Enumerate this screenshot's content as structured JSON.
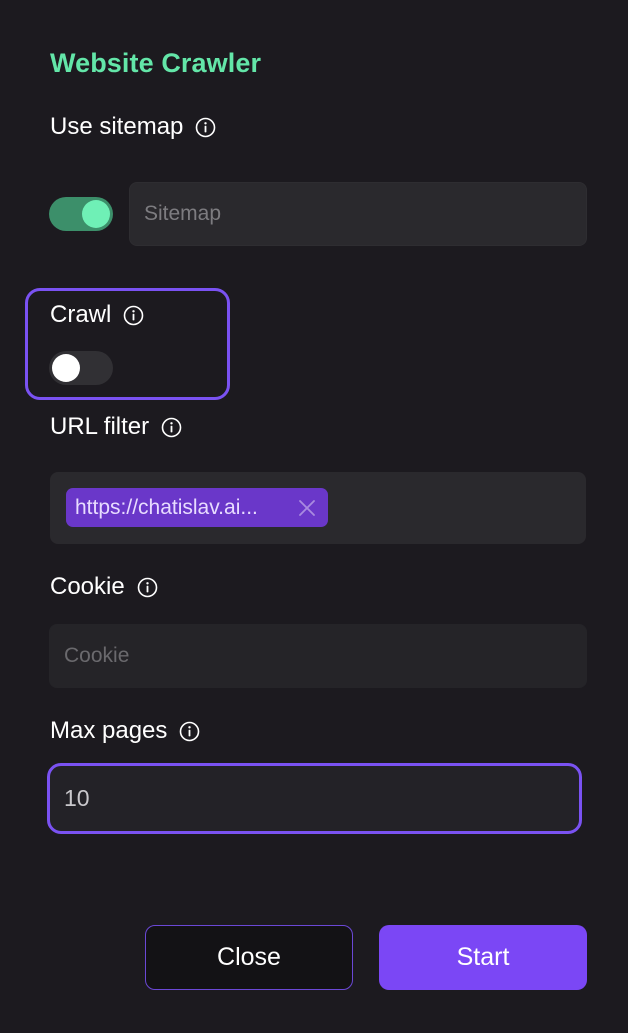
{
  "dialog": {
    "title": "Website Crawler"
  },
  "sitemap": {
    "label": "Use sitemap",
    "enabled": true,
    "placeholder": "Sitemap",
    "value": ""
  },
  "crawl": {
    "label": "Crawl",
    "enabled": false
  },
  "url_filter": {
    "label": "URL filter",
    "tags": [
      "https://chatislav.ai..."
    ]
  },
  "cookie": {
    "label": "Cookie",
    "placeholder": "Cookie",
    "value": ""
  },
  "max_pages": {
    "label": "Max pages",
    "value": "10"
  },
  "buttons": {
    "close": "Close",
    "start": "Start"
  },
  "icons": {
    "info": "info-icon",
    "remove_tag": "close-icon"
  },
  "colors": {
    "accent": "#7a52f2",
    "title_green": "#63e6a8",
    "toggle_on": "#3c8f6a",
    "primary_button": "#7b47f5",
    "tag_bg": "#6a37c9"
  }
}
